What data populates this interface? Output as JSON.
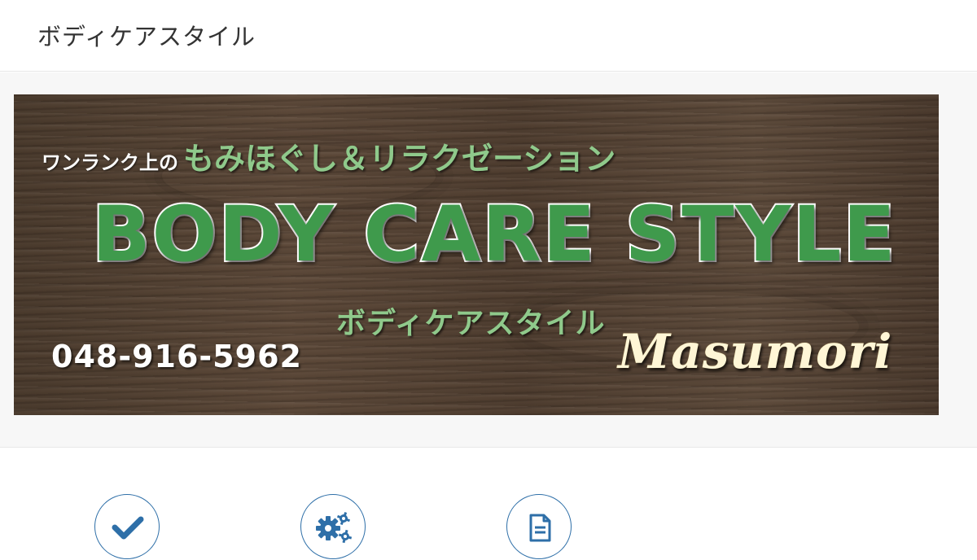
{
  "header": {
    "site_title": "ボディケアスタイル"
  },
  "banner": {
    "tagline_small": "ワンランク上の",
    "tagline_big": "もみほぐし＆リラクゼーション",
    "brand_name": "BODY CARE STYLE",
    "brand_katakana": "ボディケアスタイル",
    "phone": "048-916-5962",
    "location": "Masumori"
  },
  "features": {
    "icons": [
      "check-icon",
      "gears-icon",
      "document-icon"
    ],
    "icon_color": "#2e6fa8"
  },
  "colors": {
    "brand_green": "#3f9a4c",
    "light_green": "#8fc98b",
    "wood_brown": "#4f3d2f"
  }
}
